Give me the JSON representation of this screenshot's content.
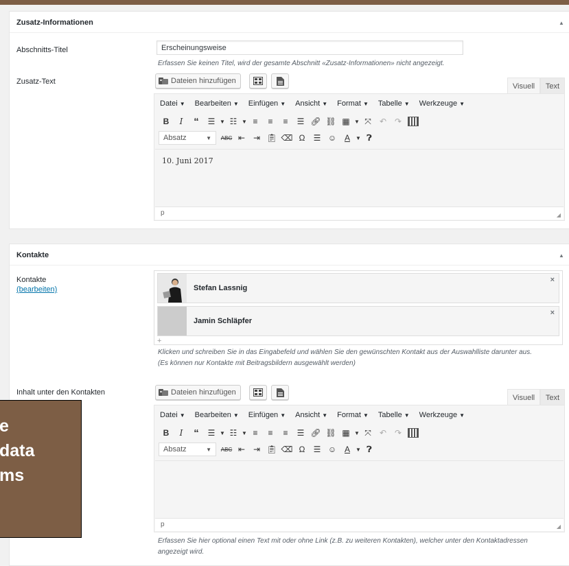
{
  "panel1": {
    "title": "Zusatz-Informationen",
    "section_title_label": "Abschnitts-Titel",
    "section_title_value": "Erscheinungsweise",
    "section_title_hint": "Erfassen Sie keinen Titel, wird der gesamte Abschnitt «Zusatz-Informationen» nicht angezeigt.",
    "text_label": "Zusatz-Text",
    "content": "10. Juni 2017"
  },
  "panel2": {
    "title": "Kontakte",
    "contacts_label": "Kontakte",
    "contacts_edit_link": "(bearbeiten)",
    "contacts": [
      {
        "name": "Stefan Lassnig",
        "has_photo": true
      },
      {
        "name": "Jamin Schläpfer",
        "has_photo": false
      }
    ],
    "add_symbol": "+",
    "contacts_hint_1": "Klicken und schreiben Sie in das Eingabefeld und wählen Sie den gewünschten Kontakt aus der Auswahlliste darunter aus.",
    "contacts_hint_2": "(Es können nur Kontakte mit Beitragsbildern ausgewählt werden)",
    "below_label": "Inhalt unter den Kontakten",
    "below_hint_1": "Erfassen Sie hier optional einen Text mit oder ohne Link (z.B. zu weiteren Kontakten), welcher unter den Kontaktadressen",
    "below_hint_2": "angezeigt wird."
  },
  "editor": {
    "add_media": "Dateien hinzufügen",
    "tab_visual": "Visuell",
    "tab_text": "Text",
    "menus": [
      "Datei",
      "Bearbeiten",
      "Einfügen",
      "Ansicht",
      "Format",
      "Tabelle",
      "Werkzeuge"
    ],
    "format_select": "Absatz",
    "status_path": "p",
    "close_symbol": "×"
  },
  "overlay": {
    "line1": "e",
    "line2": "data",
    "line3": "ms"
  },
  "colors": {
    "accent": "#7d5e45",
    "link": "#0073aa"
  }
}
